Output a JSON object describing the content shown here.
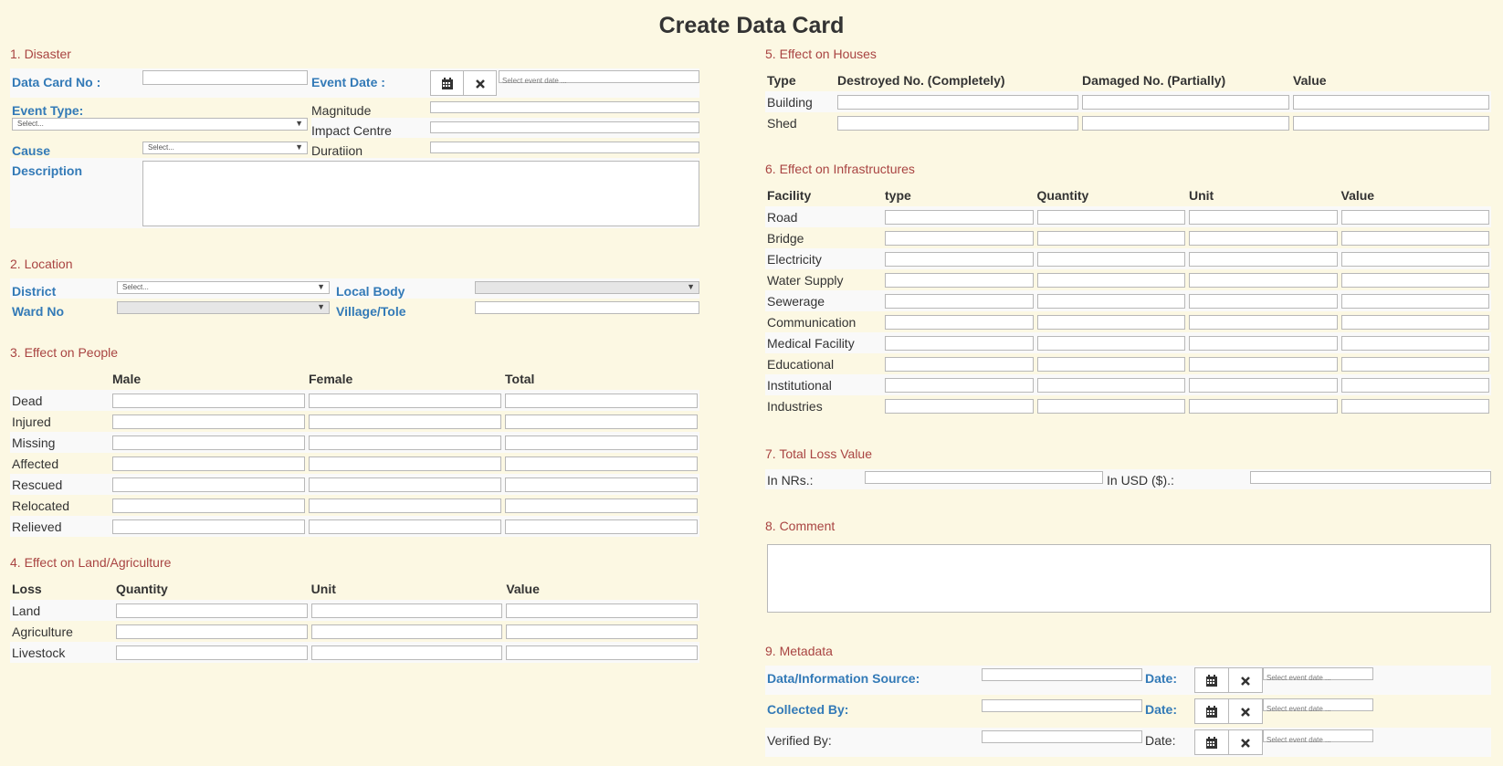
{
  "page": {
    "title": "Create Data Card"
  },
  "disaster": {
    "title": "1. Disaster",
    "data_card_no_label": "Data Card No :",
    "event_date_label": "Event Date :",
    "event_date_placeholder": "Select event date ...",
    "event_type_label": "Event Type:",
    "event_type_selected": "Select...",
    "cause_label": "Cause",
    "cause_selected": "Select...",
    "magnitude_label": "Magnitude",
    "impact_centre_label": "Impact Centre",
    "duration_label": "Duratiion",
    "description_label": "Description"
  },
  "location": {
    "title": "2. Location",
    "district_label": "District",
    "district_selected": "Select...",
    "local_body_label": "Local Body",
    "ward_no_label": "Ward No",
    "village_label": "Village/Tole"
  },
  "people": {
    "title": "3. Effect on People",
    "columns": [
      "Male",
      "Female",
      "Total"
    ],
    "rows": [
      "Dead",
      "Injured",
      "Missing",
      "Affected",
      "Rescued",
      "Relocated",
      "Relieved"
    ]
  },
  "land": {
    "title": "4. Effect on Land/Agriculture",
    "columns": [
      "Loss",
      "Quantity",
      "Unit",
      "Value"
    ],
    "rows": [
      "Land",
      "Agriculture",
      "Livestock"
    ]
  },
  "houses": {
    "title": "5. Effect on Houses",
    "columns": [
      "Type",
      "Destroyed No. (Completely)",
      "Damaged No. (Partially)",
      "Value"
    ],
    "rows": [
      "Building",
      "Shed"
    ]
  },
  "infra": {
    "title": "6. Effect on Infrastructures",
    "columns": [
      "Facility",
      "type",
      "Quantity",
      "Unit",
      "Value"
    ],
    "rows": [
      "Road",
      "Bridge",
      "Electricity",
      "Water Supply",
      "Sewerage",
      "Communication",
      "Medical Facility",
      "Educational",
      "Institutional",
      "Industries"
    ]
  },
  "total_loss": {
    "title": "7. Total Loss Value",
    "nrs_label": "In NRs.:",
    "usd_label": "In USD ($).:"
  },
  "comment": {
    "title": "8. Comment"
  },
  "metadata": {
    "title": "9. Metadata",
    "date_label": "Date:",
    "date_placeholder": "Select event date ...",
    "source_label": "Data/Information Source:",
    "collected_label": "Collected By:",
    "verified_label": "Verified By:"
  },
  "icons": {
    "calendar": "calendar-icon",
    "clear": "close-icon"
  },
  "colors": {
    "background": "#fcf8e3",
    "section_title": "#a94442",
    "label_blue": "#337ab7"
  }
}
